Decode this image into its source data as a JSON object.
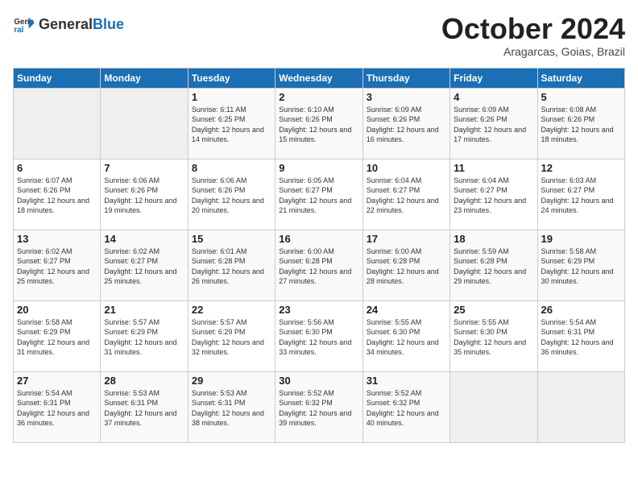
{
  "logo": {
    "general": "General",
    "blue": "Blue"
  },
  "title": "October 2024",
  "subtitle": "Aragarcas, Goias, Brazil",
  "weekdays": [
    "Sunday",
    "Monday",
    "Tuesday",
    "Wednesday",
    "Thursday",
    "Friday",
    "Saturday"
  ],
  "weeks": [
    [
      {
        "day": "",
        "empty": true
      },
      {
        "day": "",
        "empty": true
      },
      {
        "day": "1",
        "sunrise": "Sunrise: 6:11 AM",
        "sunset": "Sunset: 6:25 PM",
        "daylight": "Daylight: 12 hours and 14 minutes."
      },
      {
        "day": "2",
        "sunrise": "Sunrise: 6:10 AM",
        "sunset": "Sunset: 6:26 PM",
        "daylight": "Daylight: 12 hours and 15 minutes."
      },
      {
        "day": "3",
        "sunrise": "Sunrise: 6:09 AM",
        "sunset": "Sunset: 6:26 PM",
        "daylight": "Daylight: 12 hours and 16 minutes."
      },
      {
        "day": "4",
        "sunrise": "Sunrise: 6:09 AM",
        "sunset": "Sunset: 6:26 PM",
        "daylight": "Daylight: 12 hours and 17 minutes."
      },
      {
        "day": "5",
        "sunrise": "Sunrise: 6:08 AM",
        "sunset": "Sunset: 6:26 PM",
        "daylight": "Daylight: 12 hours and 18 minutes."
      }
    ],
    [
      {
        "day": "6",
        "sunrise": "Sunrise: 6:07 AM",
        "sunset": "Sunset: 6:26 PM",
        "daylight": "Daylight: 12 hours and 18 minutes."
      },
      {
        "day": "7",
        "sunrise": "Sunrise: 6:06 AM",
        "sunset": "Sunset: 6:26 PM",
        "daylight": "Daylight: 12 hours and 19 minutes."
      },
      {
        "day": "8",
        "sunrise": "Sunrise: 6:06 AM",
        "sunset": "Sunset: 6:26 PM",
        "daylight": "Daylight: 12 hours and 20 minutes."
      },
      {
        "day": "9",
        "sunrise": "Sunrise: 6:05 AM",
        "sunset": "Sunset: 6:27 PM",
        "daylight": "Daylight: 12 hours and 21 minutes."
      },
      {
        "day": "10",
        "sunrise": "Sunrise: 6:04 AM",
        "sunset": "Sunset: 6:27 PM",
        "daylight": "Daylight: 12 hours and 22 minutes."
      },
      {
        "day": "11",
        "sunrise": "Sunrise: 6:04 AM",
        "sunset": "Sunset: 6:27 PM",
        "daylight": "Daylight: 12 hours and 23 minutes."
      },
      {
        "day": "12",
        "sunrise": "Sunrise: 6:03 AM",
        "sunset": "Sunset: 6:27 PM",
        "daylight": "Daylight: 12 hours and 24 minutes."
      }
    ],
    [
      {
        "day": "13",
        "sunrise": "Sunrise: 6:02 AM",
        "sunset": "Sunset: 6:27 PM",
        "daylight": "Daylight: 12 hours and 25 minutes."
      },
      {
        "day": "14",
        "sunrise": "Sunrise: 6:02 AM",
        "sunset": "Sunset: 6:27 PM",
        "daylight": "Daylight: 12 hours and 25 minutes."
      },
      {
        "day": "15",
        "sunrise": "Sunrise: 6:01 AM",
        "sunset": "Sunset: 6:28 PM",
        "daylight": "Daylight: 12 hours and 26 minutes."
      },
      {
        "day": "16",
        "sunrise": "Sunrise: 6:00 AM",
        "sunset": "Sunset: 6:28 PM",
        "daylight": "Daylight: 12 hours and 27 minutes."
      },
      {
        "day": "17",
        "sunrise": "Sunrise: 6:00 AM",
        "sunset": "Sunset: 6:28 PM",
        "daylight": "Daylight: 12 hours and 28 minutes."
      },
      {
        "day": "18",
        "sunrise": "Sunrise: 5:59 AM",
        "sunset": "Sunset: 6:28 PM",
        "daylight": "Daylight: 12 hours and 29 minutes."
      },
      {
        "day": "19",
        "sunrise": "Sunrise: 5:58 AM",
        "sunset": "Sunset: 6:29 PM",
        "daylight": "Daylight: 12 hours and 30 minutes."
      }
    ],
    [
      {
        "day": "20",
        "sunrise": "Sunrise: 5:58 AM",
        "sunset": "Sunset: 6:29 PM",
        "daylight": "Daylight: 12 hours and 31 minutes."
      },
      {
        "day": "21",
        "sunrise": "Sunrise: 5:57 AM",
        "sunset": "Sunset: 6:29 PM",
        "daylight": "Daylight: 12 hours and 31 minutes."
      },
      {
        "day": "22",
        "sunrise": "Sunrise: 5:57 AM",
        "sunset": "Sunset: 6:29 PM",
        "daylight": "Daylight: 12 hours and 32 minutes."
      },
      {
        "day": "23",
        "sunrise": "Sunrise: 5:56 AM",
        "sunset": "Sunset: 6:30 PM",
        "daylight": "Daylight: 12 hours and 33 minutes."
      },
      {
        "day": "24",
        "sunrise": "Sunrise: 5:55 AM",
        "sunset": "Sunset: 6:30 PM",
        "daylight": "Daylight: 12 hours and 34 minutes."
      },
      {
        "day": "25",
        "sunrise": "Sunrise: 5:55 AM",
        "sunset": "Sunset: 6:30 PM",
        "daylight": "Daylight: 12 hours and 35 minutes."
      },
      {
        "day": "26",
        "sunrise": "Sunrise: 5:54 AM",
        "sunset": "Sunset: 6:31 PM",
        "daylight": "Daylight: 12 hours and 36 minutes."
      }
    ],
    [
      {
        "day": "27",
        "sunrise": "Sunrise: 5:54 AM",
        "sunset": "Sunset: 6:31 PM",
        "daylight": "Daylight: 12 hours and 36 minutes."
      },
      {
        "day": "28",
        "sunrise": "Sunrise: 5:53 AM",
        "sunset": "Sunset: 6:31 PM",
        "daylight": "Daylight: 12 hours and 37 minutes."
      },
      {
        "day": "29",
        "sunrise": "Sunrise: 5:53 AM",
        "sunset": "Sunset: 6:31 PM",
        "daylight": "Daylight: 12 hours and 38 minutes."
      },
      {
        "day": "30",
        "sunrise": "Sunrise: 5:52 AM",
        "sunset": "Sunset: 6:32 PM",
        "daylight": "Daylight: 12 hours and 39 minutes."
      },
      {
        "day": "31",
        "sunrise": "Sunrise: 5:52 AM",
        "sunset": "Sunset: 6:32 PM",
        "daylight": "Daylight: 12 hours and 40 minutes."
      },
      {
        "day": "",
        "empty": true
      },
      {
        "day": "",
        "empty": true
      }
    ]
  ]
}
